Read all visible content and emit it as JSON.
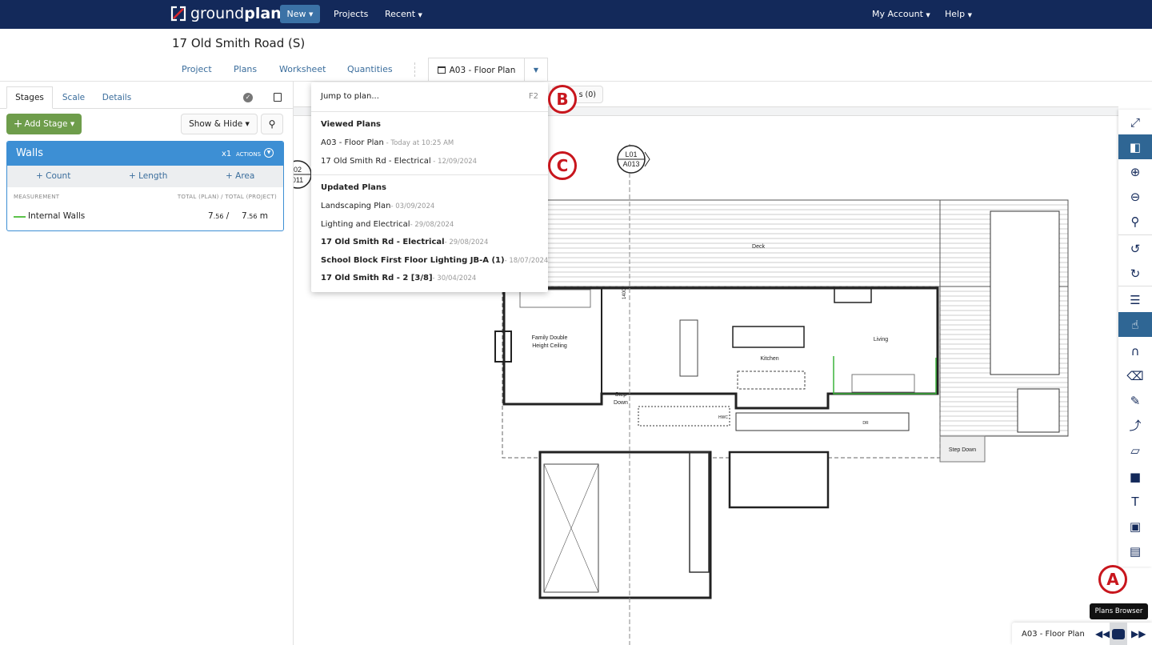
{
  "app": {
    "logo_light": "ground",
    "logo_bold": "plan"
  },
  "topnav": {
    "new": "New",
    "projects": "Projects",
    "recent": "Recent",
    "account": "My Account",
    "help": "Help"
  },
  "project": {
    "title": "17 Old Smith Road (S)"
  },
  "tabs": [
    "Project",
    "Plans",
    "Worksheet",
    "Quantities"
  ],
  "current_plan": "A03 - Floor Plan",
  "left": {
    "tabs": [
      "Stages",
      "Scale",
      "Details"
    ],
    "add_stage": "Add Stage",
    "show_hide": "Show & Hide",
    "stage": {
      "name": "Walls",
      "multiplier": "x1",
      "actions": "ACTIONS",
      "add_buttons": [
        "Count",
        "Length",
        "Area"
      ],
      "col_measurement": "MEASUREMENT",
      "col_total": "TOTAL (PLAN) / TOTAL (PROJECT)",
      "rows": [
        {
          "name": "Internal Walls",
          "color": "#5cc24a",
          "plan_int": "7",
          "plan_dec": ".56",
          "sep": "/",
          "proj_int": "7",
          "proj_dec": ".56",
          "unit": "m"
        }
      ]
    }
  },
  "toolbar": {
    "issues_label": "s (0)"
  },
  "dropdown": {
    "jump": "Jump to plan...",
    "jump_shortcut": "F2",
    "viewed_header": "Viewed Plans",
    "viewed": [
      {
        "name": "A03 - Floor Plan",
        "date": " - Today at 10:25 AM",
        "bold": false
      },
      {
        "name": "17 Old Smith Rd - Electrical",
        "date": " - 12/09/2024",
        "bold": false
      }
    ],
    "updated_header": "Updated Plans",
    "updated": [
      {
        "name": "Landscaping Plan",
        "date": "- 03/09/2024",
        "bold": false
      },
      {
        "name": "Lighting and Electrical",
        "date": "- 29/08/2024",
        "bold": false
      },
      {
        "name": "17 Old Smith Rd - Electrical",
        "date": "- 29/08/2024",
        "bold": true
      },
      {
        "name": "School Block First Floor Lighting JB-A (1)",
        "date": "- 18/07/2024",
        "bold": true
      },
      {
        "name": "17 Old Smith Rd - 2 [3/8]",
        "date": "- 30/04/2024",
        "bold": true
      }
    ]
  },
  "plan_labels": {
    "deck": "Deck",
    "family1": "Family Double",
    "family2": "Height Ceiling",
    "kitchen": "Kitchen",
    "living": "Living",
    "step": "Step",
    "down": "Down",
    "stepdown": "Step Down",
    "dim": "1400",
    "sec_a1": "L01",
    "sec_a2": "A013",
    "sec_b1": "02",
    "sec_b2": "011",
    "dr": "DR",
    "hwc": "HWC"
  },
  "right_tools": [
    "fullscreen-icon",
    "panel-toggle-icon",
    "zoom-in-icon",
    "zoom-out-icon",
    "zoom-fit-icon",
    "undo-icon",
    "redo-icon",
    "list-icon",
    "pointer-icon",
    "magnet-icon",
    "eraser-icon",
    "pencil-icon",
    "curve-icon",
    "ruler-icon",
    "shapes-icon",
    "text-icon",
    "image-icon",
    "comment-icon"
  ],
  "markers": [
    "A",
    "B",
    "C"
  ],
  "tooltip": "Plans Browser",
  "bottom": {
    "plan": "A03 - Floor Plan"
  },
  "colors": {
    "navbar": "#13295a",
    "stage_header": "#3d8fd4",
    "add_stage": "#6e9d4b",
    "marker": "#c8161d"
  }
}
